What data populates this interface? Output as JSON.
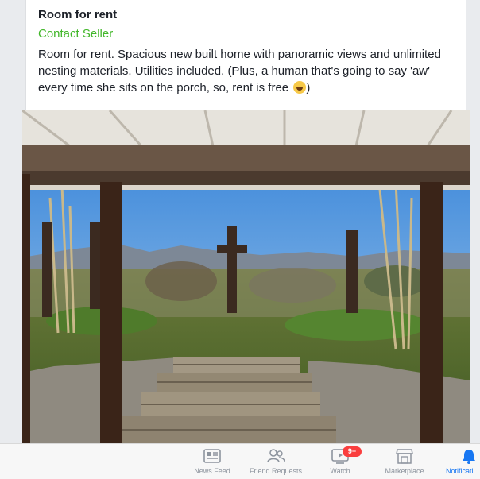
{
  "post": {
    "title": "Room for rent",
    "contact_label": "Contact Seller",
    "description": "Room for rent.  Spacious new built home with panoramic views and unlimited nesting materials.  Utilities included.  (Plus, a human that's going to say 'aw' every time she sits on the porch, so, rent is free",
    "description_tail": ")",
    "emoji": "grinning-squinting-face",
    "accent_color": "#42b72a"
  },
  "tabbar": {
    "tabs": [
      {
        "label": "News Feed",
        "icon": "news-feed-icon"
      },
      {
        "label": "Friend Requests",
        "icon": "friend-requests-icon"
      },
      {
        "label": "Watch",
        "icon": "watch-icon",
        "badge": "9+"
      },
      {
        "label": "Marketplace",
        "icon": "marketplace-icon"
      },
      {
        "label": "Notificati",
        "icon": "bell-icon",
        "active": true
      }
    ],
    "active_color": "#1877f2",
    "badge_color": "#fa3e3e"
  }
}
